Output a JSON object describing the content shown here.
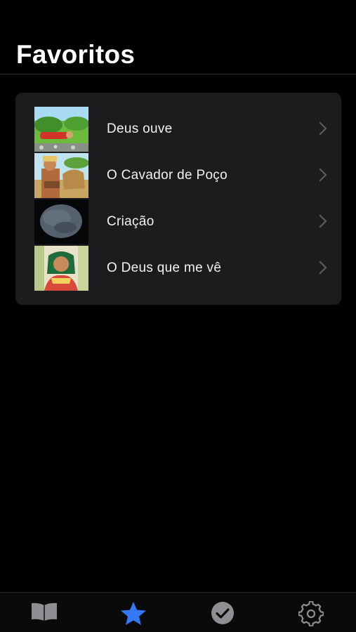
{
  "header": {
    "title": "Favoritos"
  },
  "favorites": [
    {
      "label": "Deus ouve",
      "thumbnail": "illustration-man-lying-on-grass"
    },
    {
      "label": "O Cavador de Poço",
      "thumbnail": "illustration-man-with-camel"
    },
    {
      "label": "Criação",
      "thumbnail": "illustration-dark-planet"
    },
    {
      "label": "O Deus que me vê",
      "thumbnail": "illustration-woman-portrait"
    }
  ],
  "tabbar": {
    "items": [
      {
        "icon": "book-icon",
        "active": false
      },
      {
        "icon": "star-icon",
        "active": true
      },
      {
        "icon": "checkmark-circle-icon",
        "active": false
      },
      {
        "icon": "gear-icon",
        "active": false
      }
    ]
  },
  "colors": {
    "accent": "#3478f6",
    "card": "#1c1c1e",
    "tab_inactive": "#8e8e93",
    "background": "#000000"
  }
}
